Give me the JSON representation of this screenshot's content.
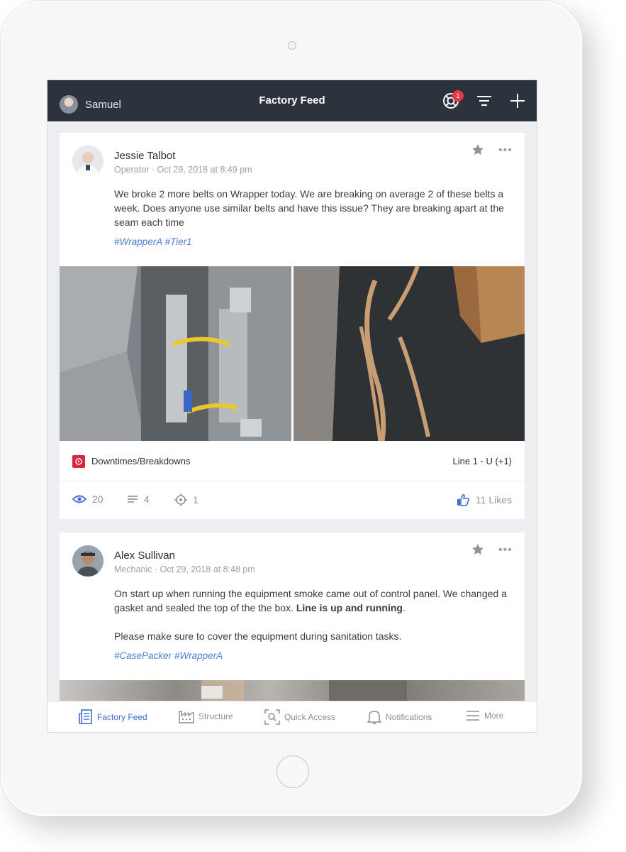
{
  "header": {
    "user_name": "Samuel",
    "title": "Factory Feed",
    "notification_count": "1"
  },
  "posts": [
    {
      "author": "Jessie Talbot",
      "role": "Operator",
      "timestamp": "Oct 29, 2018 at 8:49 pm",
      "text": "We broke 2 more belts on Wrapper today. We are breaking on average 2 of these belts a week. Does anyone use similar belts and have this issue? They are breaking apart at the seam each time",
      "tags": [
        "#WrapperA",
        "#Tier1"
      ],
      "category": "Downtimes/Breakdowns",
      "line": "Line 1 - U (+1)",
      "views": "20",
      "comments": "4",
      "follows": "1",
      "likes": "11 Likes"
    },
    {
      "author": "Alex Sullivan",
      "role": "Mechanic",
      "timestamp": "Oct 29, 2018 at 8:48 pm",
      "text_main": "On start up when running the equipment smoke came out of control panel. We changed a gasket and sealed the top of the the box.",
      "text_bold": "Line is up and running",
      "text_end": ".",
      "text_second": "Please make sure to cover the equipment during sanitation tasks.",
      "tags": [
        "#CasePacker",
        "#WrapperA"
      ]
    }
  ],
  "separator": "·",
  "more_glyph": "•••",
  "tabbar": {
    "items": [
      {
        "label": "Factory Feed",
        "icon": "feed-icon",
        "active": true
      },
      {
        "label": "Structure",
        "icon": "factory-icon"
      },
      {
        "label": "Quick Access",
        "icon": "scan-icon"
      },
      {
        "label": "Notifications",
        "icon": "bell-icon"
      },
      {
        "label": "More",
        "icon": "menu-icon"
      }
    ]
  },
  "colors": {
    "topbar": "#2d333c",
    "accent": "#3f6fd1",
    "tag": "#4f7fd6",
    "badge": "#e8364b",
    "category": "#d7263d"
  }
}
